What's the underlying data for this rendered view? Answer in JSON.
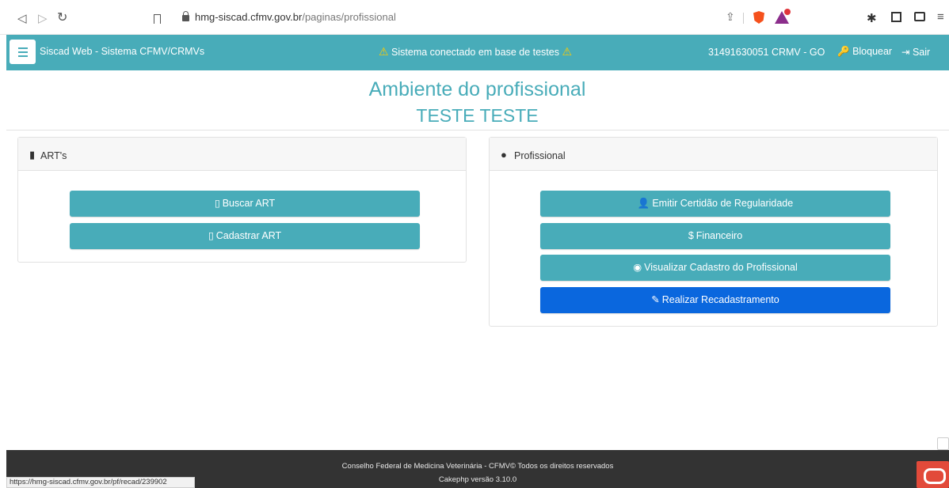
{
  "browser": {
    "url_host": "hmg-siscad.cfmv.gov.br",
    "url_path": "/paginas/profissional"
  },
  "navbar": {
    "brand": "Siscad Web - Sistema CFMV/CRMVs",
    "warning": "Sistema conectado em base de testes",
    "user": "31491630051 CRMV - GO",
    "lock_label": "Bloquear",
    "logout_label": "Sair"
  },
  "page": {
    "title": "Ambiente do profissional",
    "subtitle": "TESTE TESTE"
  },
  "cards": {
    "arts": {
      "title": "ART's",
      "buttons": [
        "Buscar ART",
        "Cadastrar ART"
      ]
    },
    "profissional": {
      "title": "Profissional",
      "buttons": [
        "Emitir Certidão de Regularidade",
        "Financeiro",
        "Visualizar Cadastro do Profissional",
        "Realizar Recadastramento"
      ]
    }
  },
  "footer": {
    "line1": "Conselho Federal de Medicina Veterinária - CFMV© Todos os direitos reservados",
    "line2": "Cakephp versão 3.10.0"
  },
  "status_url": "https://hmg-siscad.cfmv.gov.br/pf/recad/239902",
  "colors": {
    "teal": "#48acb9",
    "blue": "#0a67de",
    "footer": "#333333"
  }
}
